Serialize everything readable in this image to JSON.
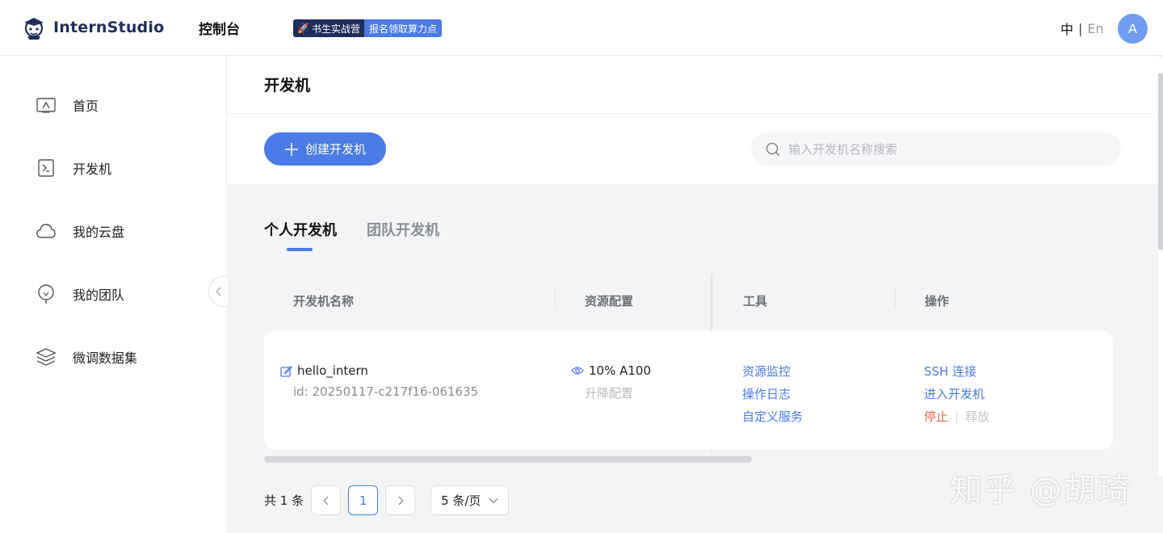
{
  "header": {
    "logo_text": "InternStudio",
    "console_title": "控制台",
    "promo_left": "书生实战营",
    "promo_right": "报名领取算力点",
    "lang_zh": "中",
    "lang_sep": "|",
    "lang_en": "En",
    "avatar_letter": "A"
  },
  "sidebar": {
    "items": [
      {
        "label": "首页",
        "icon": "home-icon"
      },
      {
        "label": "开发机",
        "icon": "terminal-icon"
      },
      {
        "label": "我的云盘",
        "icon": "cloud-icon"
      },
      {
        "label": "我的团队",
        "icon": "team-icon"
      },
      {
        "label": "微调数据集",
        "icon": "layers-icon"
      }
    ]
  },
  "main": {
    "page_title": "开发机",
    "create_button": "创建开发机",
    "search_placeholder": "输入开发机名称搜索",
    "tabs": [
      {
        "label": "个人开发机",
        "active": true
      },
      {
        "label": "团队开发机",
        "active": false
      }
    ],
    "columns": [
      "开发机名称",
      "资源配置",
      "工具",
      "操作"
    ],
    "rows": [
      {
        "name": "hello_intern",
        "id": "id: 20250117-c217f16-061635",
        "resource": "10% A100",
        "resource_action": "升降配置",
        "tools": [
          "资源监控",
          "操作日志",
          "自定义服务"
        ],
        "ops": {
          "ssh": "SSH 连接",
          "enter": "进入开发机",
          "stop": "停止",
          "release": "释放"
        }
      }
    ],
    "pagination": {
      "total": "共 1 条",
      "current_page": "1",
      "page_size": "5 条/页"
    }
  },
  "watermark": "知乎 @胡琦",
  "colors": {
    "accent": "#4a7be6",
    "danger": "#e8634a",
    "brand_dark": "#1f2d5a"
  }
}
